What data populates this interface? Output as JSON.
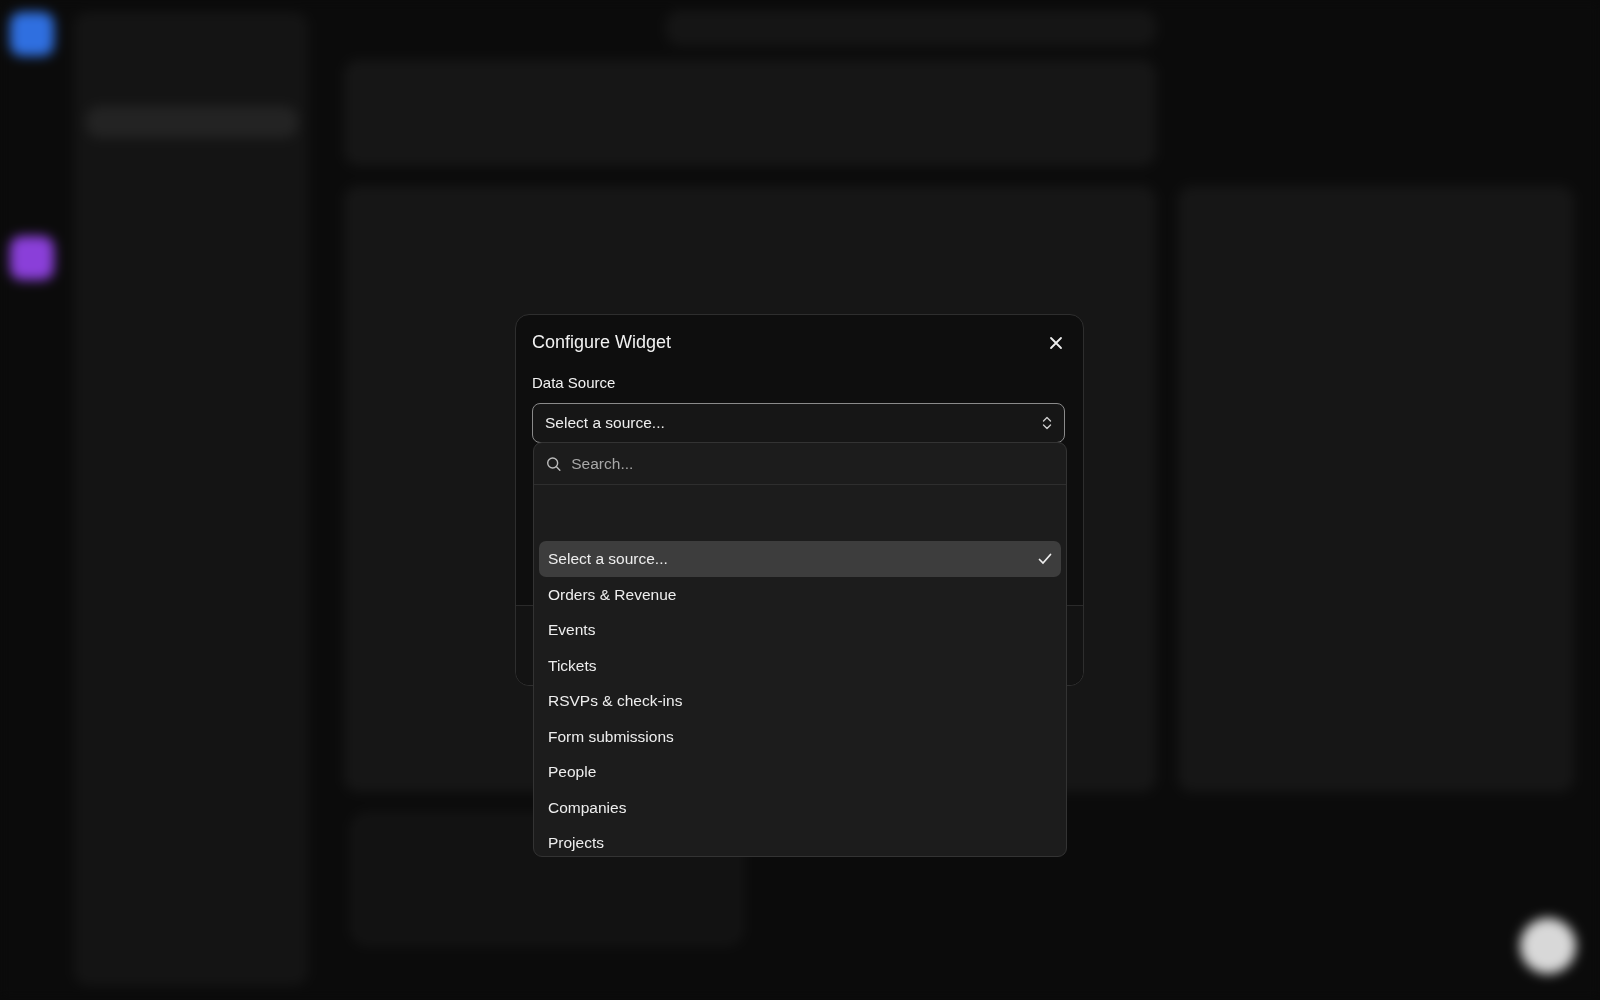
{
  "modal": {
    "title": "Configure Widget",
    "field_label": "Data Source",
    "select": {
      "value": "Select a source..."
    },
    "dropdown": {
      "placeholder": "Search...",
      "options": [
        {
          "label": "Select a source...",
          "selected": true
        },
        {
          "label": "Orders & Revenue",
          "selected": false
        },
        {
          "label": "Events",
          "selected": false
        },
        {
          "label": "Tickets",
          "selected": false
        },
        {
          "label": "RSVPs & check-ins",
          "selected": false
        },
        {
          "label": "Form submissions",
          "selected": false
        },
        {
          "label": "People",
          "selected": false
        },
        {
          "label": "Companies",
          "selected": false
        },
        {
          "label": "Projects",
          "selected": false
        }
      ]
    }
  }
}
